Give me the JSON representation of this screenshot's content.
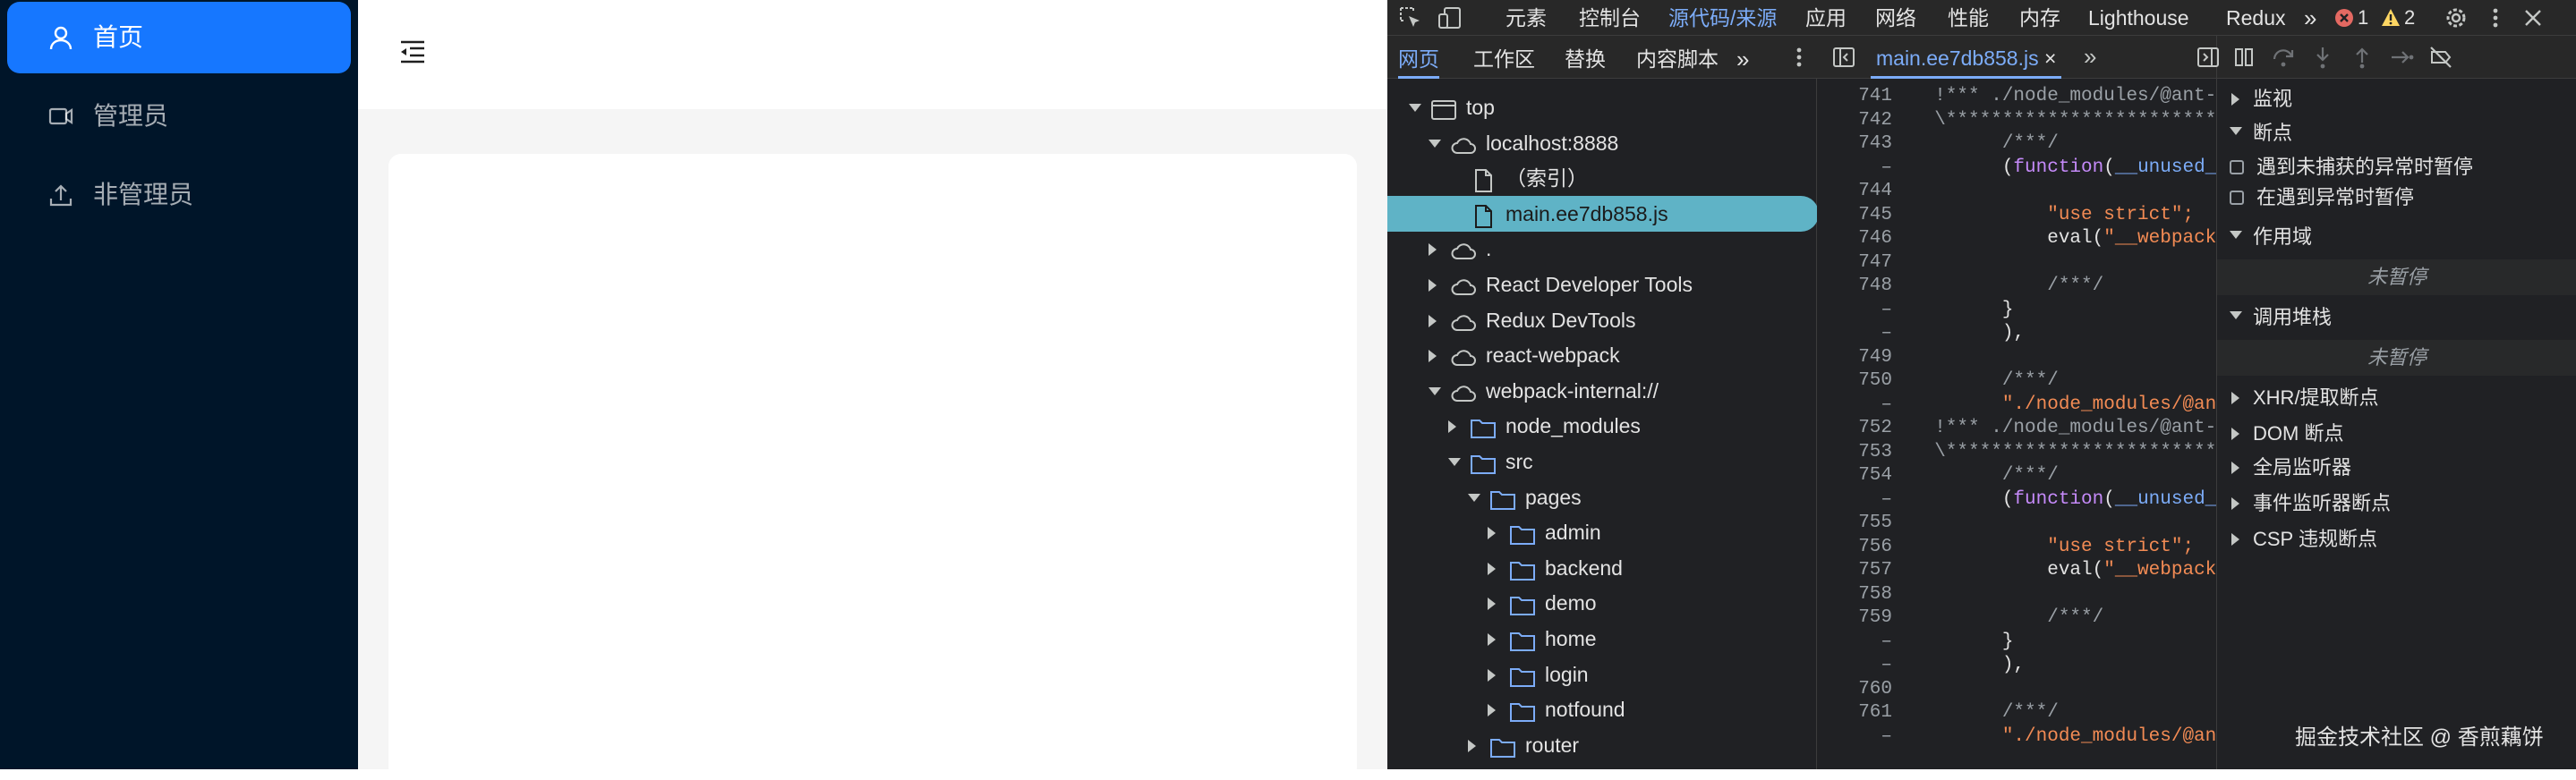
{
  "app": {
    "menu": [
      {
        "label": "首页",
        "icon": "user-icon",
        "active": true
      },
      {
        "label": "管理员",
        "icon": "video-camera-icon",
        "active": false
      },
      {
        "label": "非管理员",
        "icon": "upload-icon",
        "active": false
      }
    ],
    "header": {
      "fold_icon": "menu-fold-icon"
    }
  },
  "devtools": {
    "top_tabs": [
      "元素",
      "控制台",
      "源代码/来源",
      "应用",
      "网络",
      "性能",
      "内存",
      "Lighthouse",
      "Redux"
    ],
    "active_top_tab": "源代码/来源",
    "error_count": "1",
    "warning_count": "2",
    "navigator_tabs": [
      "网页",
      "工作区",
      "替换",
      "内容脚本"
    ],
    "active_navigator_tab": "网页",
    "tree": [
      {
        "label": "top",
        "depth": 0,
        "kind": "frame",
        "expand": "down"
      },
      {
        "label": "localhost:8888",
        "depth": 1,
        "kind": "cloud",
        "expand": "down"
      },
      {
        "label": "（索引）",
        "depth": 2,
        "kind": "file",
        "expand": "none"
      },
      {
        "label": "main.ee7db858.js",
        "depth": 2,
        "kind": "file",
        "expand": "none",
        "selected": true
      },
      {
        "label": ".",
        "depth": 1,
        "kind": "cloud",
        "expand": "right"
      },
      {
        "label": "React Developer Tools",
        "depth": 1,
        "kind": "cloud",
        "expand": "right"
      },
      {
        "label": "Redux DevTools",
        "depth": 1,
        "kind": "cloud",
        "expand": "right"
      },
      {
        "label": "react-webpack",
        "depth": 1,
        "kind": "cloud",
        "expand": "right"
      },
      {
        "label": "webpack-internal://",
        "depth": 1,
        "kind": "cloud",
        "expand": "down"
      },
      {
        "label": "node_modules",
        "depth": 2,
        "kind": "folder",
        "expand": "right"
      },
      {
        "label": "src",
        "depth": 2,
        "kind": "folder",
        "expand": "down"
      },
      {
        "label": "pages",
        "depth": 3,
        "kind": "folder",
        "expand": "down"
      },
      {
        "label": "admin",
        "depth": 4,
        "kind": "folder",
        "expand": "right"
      },
      {
        "label": "backend",
        "depth": 4,
        "kind": "folder",
        "expand": "right"
      },
      {
        "label": "demo",
        "depth": 4,
        "kind": "folder",
        "expand": "right"
      },
      {
        "label": "home",
        "depth": 4,
        "kind": "folder",
        "expand": "right"
      },
      {
        "label": "login",
        "depth": 4,
        "kind": "folder",
        "expand": "right"
      },
      {
        "label": "notfound",
        "depth": 4,
        "kind": "folder",
        "expand": "right"
      },
      {
        "label": "router",
        "depth": 3,
        "kind": "folder",
        "expand": "right"
      }
    ],
    "editor_tab": "main.ee7db858.js",
    "code_lines": [
      {
        "ln": "741",
        "text": "  !*** ./node_modules/@ant-d",
        "cls": "c-com"
      },
      {
        "ln": "742",
        "text": "  \\*************************",
        "cls": "c-com"
      },
      {
        "ln": "743",
        "text": "        /***/",
        "cls": "c-com"
      },
      {
        "ln": "–",
        "text": "        (function(__unused_w",
        "cls": "fn"
      },
      {
        "ln": "744",
        "text": "",
        "cls": ""
      },
      {
        "ln": "745",
        "text": "            \"use strict\";",
        "cls": "c-str"
      },
      {
        "ln": "746",
        "text": "            eval(\"__webpack_",
        "cls": "eval"
      },
      {
        "ln": "747",
        "text": "",
        "cls": ""
      },
      {
        "ln": "748",
        "text": "            /***/",
        "cls": "c-com"
      },
      {
        "ln": "–",
        "text": "        }",
        "cls": ""
      },
      {
        "ln": "–",
        "text": "        ),",
        "cls": ""
      },
      {
        "ln": "749",
        "text": "",
        "cls": ""
      },
      {
        "ln": "750",
        "text": "        /***/",
        "cls": "c-com"
      },
      {
        "ln": "–",
        "text": "        \"./node_modules/@ant",
        "cls": "c-str"
      },
      {
        "ln": "752",
        "text": "  !*** ./node_modules/@ant-d",
        "cls": "c-com"
      },
      {
        "ln": "753",
        "text": "  \\*************************",
        "cls": "c-com"
      },
      {
        "ln": "754",
        "text": "        /***/",
        "cls": "c-com"
      },
      {
        "ln": "–",
        "text": "        (function(__unused_w",
        "cls": "fn"
      },
      {
        "ln": "755",
        "text": "",
        "cls": ""
      },
      {
        "ln": "756",
        "text": "            \"use strict\";",
        "cls": "c-str"
      },
      {
        "ln": "757",
        "text": "            eval(\"__webpack_",
        "cls": "eval"
      },
      {
        "ln": "758",
        "text": "",
        "cls": ""
      },
      {
        "ln": "759",
        "text": "            /***/",
        "cls": "c-com"
      },
      {
        "ln": "–",
        "text": "        }",
        "cls": ""
      },
      {
        "ln": "–",
        "text": "        ),",
        "cls": ""
      },
      {
        "ln": "760",
        "text": "",
        "cls": ""
      },
      {
        "ln": "761",
        "text": "        /***/",
        "cls": "c-com"
      },
      {
        "ln": "–",
        "text": "        \"./node_modules/@ant",
        "cls": "c-str"
      }
    ],
    "debugger": {
      "watch": "监视",
      "breakpoints": "断点",
      "pause_uncaught": "遇到未捕获的异常时暂停",
      "pause_caught": "在遇到异常时暂停",
      "scope": "作用域",
      "scope_status": "未暂停",
      "call_stack": "调用堆栈",
      "call_stack_status": "未暂停",
      "collapsed_sections": [
        "XHR/提取断点",
        "DOM 断点",
        "全局监听器",
        "事件监听器断点",
        "CSP 违规断点"
      ]
    }
  },
  "watermark": "掘金技术社区 @ 香煎藕饼"
}
